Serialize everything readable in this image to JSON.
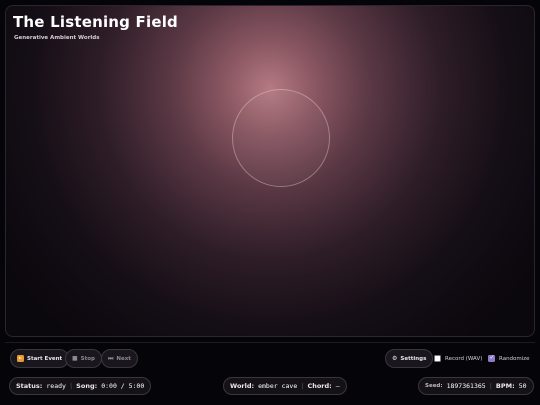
{
  "header": {
    "title": "The Listening Field",
    "subtitle": "Generative Ambient Worlds"
  },
  "controls": {
    "start_label": "Start Event",
    "stop_label": "Stop",
    "next_label": "Next",
    "settings_label": "Settings",
    "record_label": "Record (WAV)",
    "record_checked": false,
    "randomize_label": "Randomize",
    "randomize_checked": true
  },
  "status": {
    "status_label": "Status:",
    "status_value": "ready",
    "song_label": "Song:",
    "song_value": "0:00 / 5:00",
    "world_label": "World:",
    "world_value": "ember cave",
    "chord_label": "Chord:",
    "chord_value": "–",
    "seed_label": "Seed:",
    "seed_value": "1897361365",
    "bpm_label": "BPM:",
    "bpm_value": "50"
  },
  "colors": {
    "glow": "#b57a82",
    "accent_orange": "#e89a2c",
    "checkbox_accent": "#8f7cc9"
  },
  "icons": {
    "start": "play-icon",
    "stop": "stop-icon",
    "next": "skip-next-icon",
    "settings": "gear-icon"
  }
}
